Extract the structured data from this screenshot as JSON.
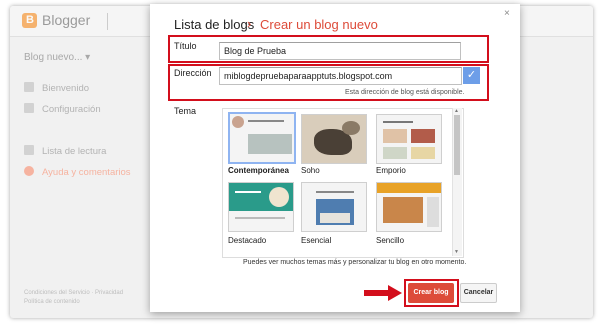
{
  "app": {
    "brand": "Blogger",
    "logo_letter": "B"
  },
  "sidebar": {
    "blog_selector": "Blog nuevo...",
    "items": [
      {
        "label": "Bienvenido",
        "icon": "page-icon"
      },
      {
        "label": "Configuración",
        "icon": "gear-icon"
      },
      {
        "label": "Lista de lectura",
        "icon": "bookmark-icon"
      },
      {
        "label": "Ayuda y comentarios",
        "icon": "help-icon"
      }
    ],
    "footer_lines": [
      "Condiciones del Servicio · Privacidad",
      "Política de contenido"
    ]
  },
  "dialog": {
    "breadcrumb_root": "Lista de blogs",
    "breadcrumb_sep": "›",
    "title": "Crear un blog nuevo",
    "close_glyph": "×",
    "title_label": "Título",
    "title_value": "Blog de Prueba",
    "address_label": "Dirección",
    "address_value": "miblogdepruebaparaapptuts.blogspot.com",
    "address_check_glyph": "✓",
    "address_status": "Esta dirección de blog está disponible.",
    "theme_label": "Tema",
    "themes": [
      {
        "name": "Contemporánea",
        "selected": true
      },
      {
        "name": "Soho",
        "selected": false
      },
      {
        "name": "Emporio",
        "selected": false
      },
      {
        "name": "Destacado",
        "selected": false
      },
      {
        "name": "Esencial",
        "selected": false
      },
      {
        "name": "Sencillo",
        "selected": false
      }
    ],
    "hint": "Puedes ver muchos temas más y personalizar tu blog en otro momento.",
    "create_button": "Crear blog",
    "cancel_button": "Cancelar"
  },
  "colors": {
    "accent": "#dd4b39",
    "highlight": "#d30e1c",
    "check": "#6d9ee8"
  }
}
